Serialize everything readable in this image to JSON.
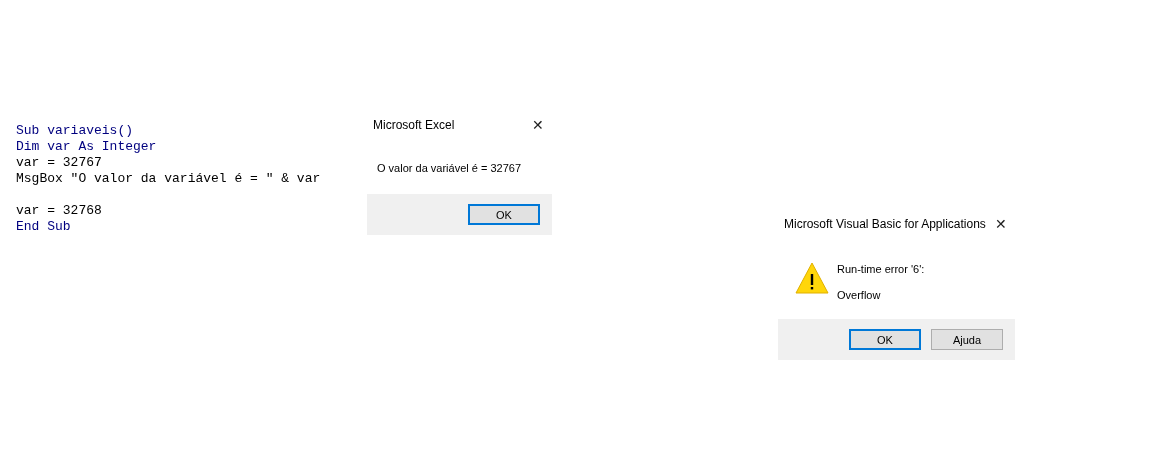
{
  "code": {
    "blocks": [
      {
        "lines": [
          {
            "text": "Sub variaveis()",
            "kind": "keyword"
          },
          {
            "text": "Dim var As Integer",
            "kind": "keyword"
          },
          {
            "text": "var = 32767",
            "kind": "plain"
          },
          {
            "text": "MsgBox \"O valor da variável é = \" & var",
            "kind": "plain"
          }
        ]
      },
      {
        "lines": [
          {
            "text": "var = 32768",
            "kind": "plain"
          },
          {
            "text": "End Sub",
            "kind": "keyword"
          }
        ]
      }
    ]
  },
  "dialogs": [
    {
      "title": "Microsoft Excel",
      "close": "✕",
      "kind": "plain",
      "messages": [
        "O valor da variável é = 32767"
      ],
      "buttons": [
        {
          "label": "OK",
          "selected": true
        }
      ]
    },
    {
      "title": "Microsoft Visual Basic for Applications",
      "close": "✕",
      "kind": "warning",
      "messages": [
        "Run-time error '6':",
        "Overflow"
      ],
      "buttons": [
        {
          "label": "OK",
          "selected": true
        },
        {
          "label": "Ajuda",
          "selected": false
        }
      ]
    }
  ]
}
